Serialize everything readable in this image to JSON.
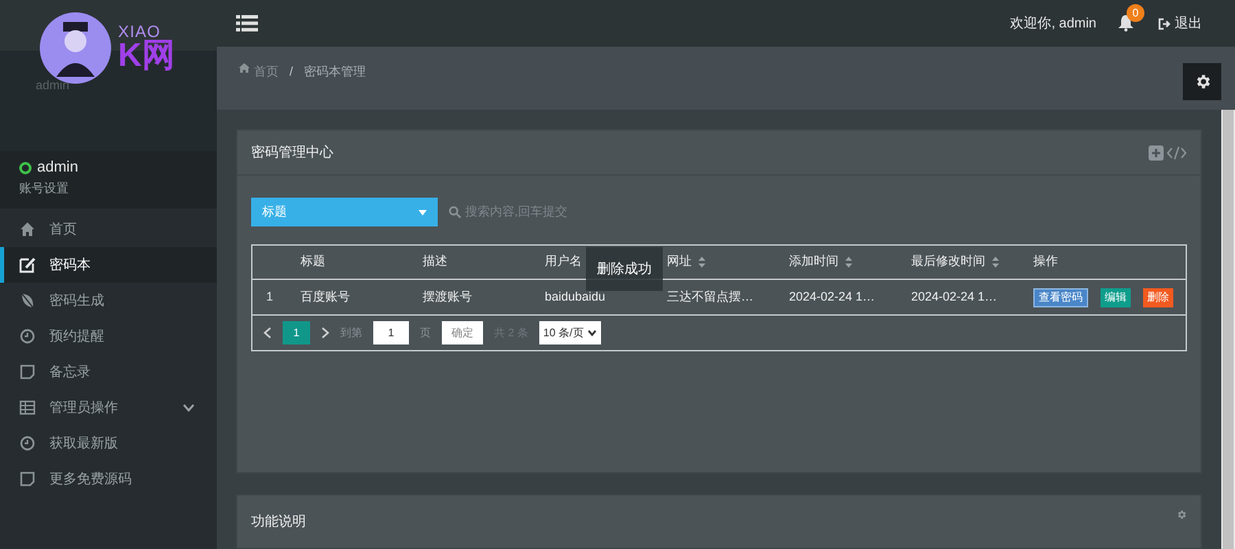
{
  "logo": {
    "text_top": "XIAO",
    "text_main": "K网",
    "alt": "admin"
  },
  "user": {
    "name": "admin",
    "online": true,
    "settings": "账号设置"
  },
  "sidebar": {
    "items": [
      {
        "label": "首页",
        "kind": "home",
        "selected": false,
        "expandable": false
      },
      {
        "label": "密码本",
        "kind": "edit",
        "selected": true,
        "expandable": false
      },
      {
        "label": "密码生成",
        "kind": "leaf",
        "selected": false,
        "expandable": false
      },
      {
        "label": "预约提醒",
        "kind": "clock",
        "selected": false,
        "expandable": false
      },
      {
        "label": "备忘录",
        "kind": "note",
        "selected": false,
        "expandable": false
      },
      {
        "label": "管理员操作",
        "kind": "table",
        "selected": false,
        "expandable": true
      },
      {
        "label": "获取最新版",
        "kind": "clock",
        "selected": false,
        "expandable": false
      },
      {
        "label": "更多免费源码",
        "kind": "note",
        "selected": false,
        "expandable": false
      }
    ]
  },
  "topbar": {
    "welcome": "欢迎你, admin",
    "notifications": "0",
    "logout": "退出"
  },
  "breadcrumb": {
    "items": [
      "首页",
      "密码本管理"
    ],
    "separator": "/"
  },
  "panel": {
    "title": "密码管理中心",
    "filter": {
      "value": "标题",
      "placeholder": "搜索内容,回车提交"
    },
    "table": {
      "columns": [
        {
          "label": "标题",
          "sortable": false
        },
        {
          "label": "描述",
          "sortable": false
        },
        {
          "label": "用户名",
          "sortable": false
        },
        {
          "label": "网址",
          "sortable": true
        },
        {
          "label": "添加时间",
          "sortable": true
        },
        {
          "label": "最后修改时间",
          "sortable": true
        },
        {
          "label": "操作",
          "sortable": false
        }
      ],
      "rows": [
        {
          "index": "1",
          "cells": [
            "百度账号",
            "摆渡账号",
            "baidubaidu",
            "三达不留点摆…",
            "2024-02-24 1…",
            "2024-02-24 1…"
          ],
          "actions": [
            {
              "label": "查看密码",
              "kind": "view"
            },
            {
              "label": "编辑",
              "kind": "edit"
            },
            {
              "label": "删除",
              "kind": "delete"
            }
          ]
        }
      ]
    },
    "pager": {
      "current": "1",
      "goto_label": "到第",
      "goto_value": "1",
      "page_label": "页",
      "confirm": "确定",
      "total": "共 2 条",
      "page_size": "10 条/页"
    }
  },
  "toast": "删除成功",
  "panel2": {
    "title": "功能说明"
  }
}
